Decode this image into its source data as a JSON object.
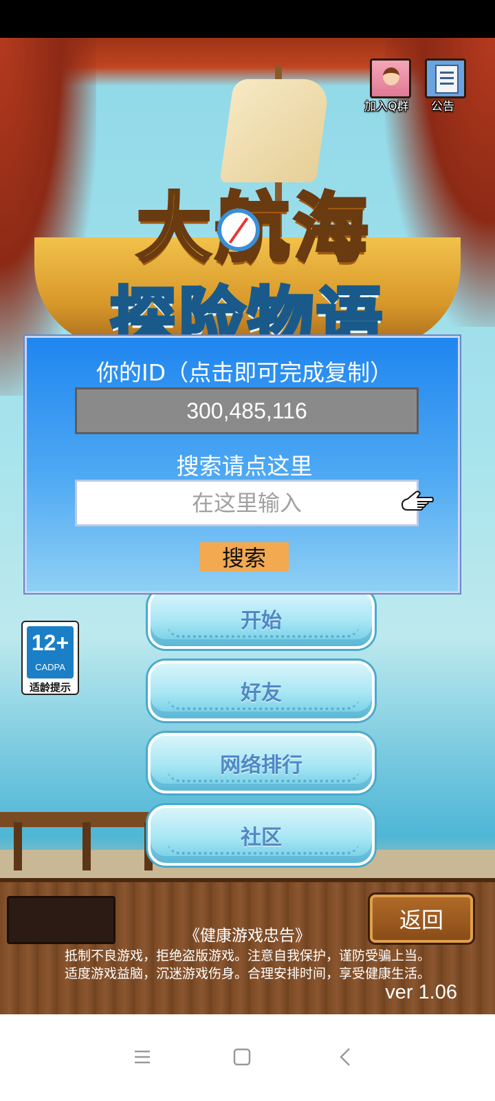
{
  "game": {
    "logo_line1": "大航海",
    "logo_line2": "探险物语"
  },
  "top_icons": {
    "qq_group_label": "加入Q群",
    "notice_label": "公告"
  },
  "id_panel": {
    "title": "你的ID（点击即可完成复制）",
    "id_value": "300,485,116",
    "search_hint": "搜索请点这里",
    "search_placeholder": "在这里输入",
    "search_button": "搜索"
  },
  "menu": {
    "start": "开始",
    "friends": "好友",
    "ranking": "网络排行",
    "community": "社区"
  },
  "age_rating": {
    "age": "12+",
    "org": "CADPA",
    "tip": "适龄提示"
  },
  "footer": {
    "back_button": "返回",
    "advice_title": "《健康游戏忠告》",
    "advice_line1": "抵制不良游戏，拒绝盗版游戏。注意自我保护，谨防受骗上当。",
    "advice_line2": "适度游戏益脑，沉迷游戏伤身。合理安排时间，享受健康生活。",
    "version": "ver 1.06"
  },
  "colors": {
    "panel_blue": "#1f86f0",
    "search_button": "#f2a950",
    "menu_text": "#4f88c4"
  }
}
